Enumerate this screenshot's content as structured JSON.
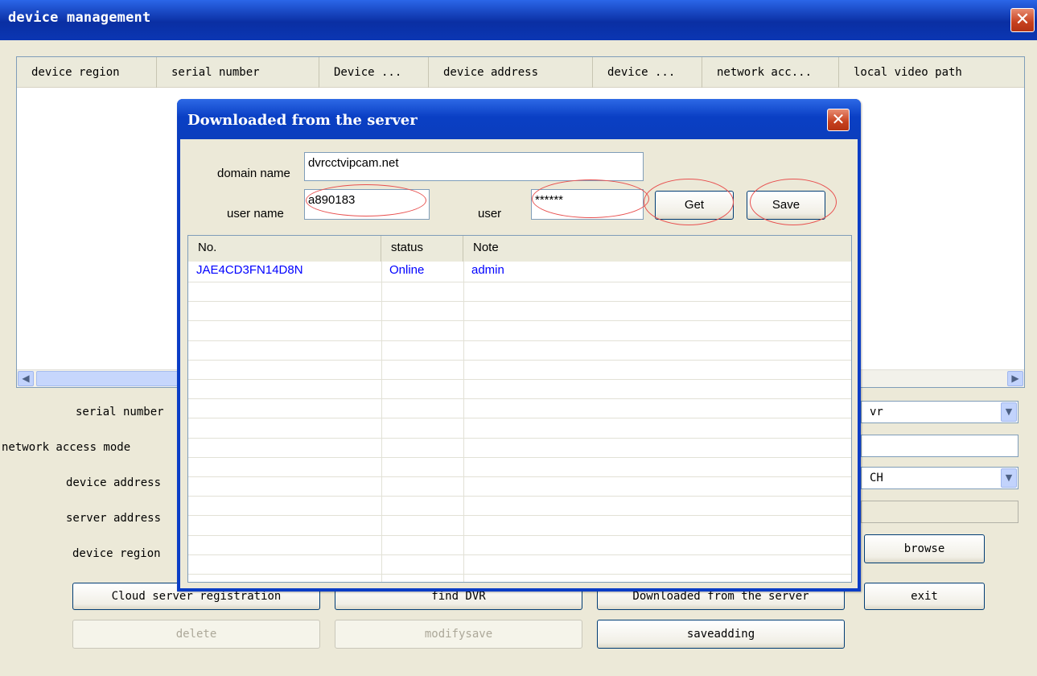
{
  "window": {
    "title": "device management",
    "close_glyph": "✕"
  },
  "main_list": {
    "columns": [
      "device region",
      "serial number",
      "Device ...",
      "device address",
      "device ...",
      "network acc...",
      "local video path"
    ],
    "scroll_left": "◀",
    "scroll_right": "▶"
  },
  "form": {
    "labels": {
      "serial_number": "serial number",
      "network_access_mode": "network access mode",
      "device_address": "device address",
      "server_address": "server address",
      "device_region": "device region"
    },
    "right_select_1": "vr",
    "right_select_2": "CH",
    "select_arrow": "▼"
  },
  "buttons": {
    "browse": "browse",
    "cloud_registration": "Cloud server registration",
    "find_dvr": "find DVR",
    "downloaded": "Downloaded from the server",
    "exit": "exit",
    "delete": "delete",
    "modify_save": "modifysave",
    "save_adding": "saveadding"
  },
  "dialog": {
    "title": "Downloaded from the server",
    "close_glyph": "✕",
    "domain_label": "domain name",
    "domain_value": "dvrcctvipcam.net",
    "username_label": "user name",
    "username_value": "a890183",
    "password_label": "user",
    "password_value": "******",
    "get_label": "Get",
    "save_label": "Save",
    "columns": [
      "No.",
      "status",
      "Note"
    ],
    "rows": [
      {
        "no": "JAE4CD3FN14D8N",
        "status": "Online",
        "note": "admin"
      }
    ]
  },
  "colors": {
    "title_bar": "#0b3dc6",
    "annotation_oval": "#e8504f",
    "row_text": "#0000ff"
  }
}
